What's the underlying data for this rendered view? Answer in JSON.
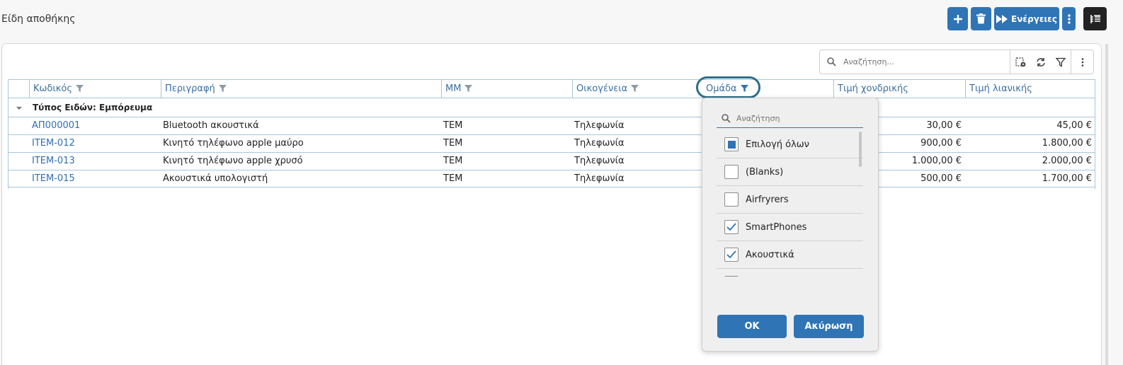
{
  "page": {
    "title": "Είδη αποθήκης"
  },
  "toolbar": {
    "add_icon": "plus-icon",
    "delete_icon": "trash-icon",
    "actions_label": "Ενέργειες",
    "more_icon": "vertical-dots-icon",
    "layout_icon": "list-tree-icon"
  },
  "grid_tools": {
    "search_placeholder": "Αναζήτηση...",
    "icons": [
      "add-view-icon",
      "refresh-icon",
      "filter-icon",
      "vertical-dots-icon"
    ]
  },
  "columns": [
    {
      "label": "Κωδικός",
      "filter": true
    },
    {
      "label": "Περιγραφή",
      "filter": true
    },
    {
      "label": "ΜΜ",
      "filter": true
    },
    {
      "label": "Οικογένεια",
      "filter": true
    },
    {
      "label": "Ομάδα",
      "filter": true,
      "active_filter": true
    },
    {
      "label": "Τιμή χονδρικής",
      "filter": false
    },
    {
      "label": "Τιμή λιανικής",
      "filter": false
    }
  ],
  "group": {
    "label": "Τύπος Ειδών: Εμπόρευμα"
  },
  "rows": [
    {
      "code": "ΑΠ000001",
      "description": "Bluetooth ακουστικά",
      "unit": "ΤΕΜ",
      "family": "Τηλεφωνία",
      "wholesale": "30,00 €",
      "retail": "45,00 €"
    },
    {
      "code": "ITEM-012",
      "description": "Κινητό τηλέφωνο apple μαύρο",
      "unit": "ΤΕΜ",
      "family": "Τηλεφωνία",
      "wholesale": "900,00 €",
      "retail": "1.800,00 €"
    },
    {
      "code": "ITEM-013",
      "description": "Κινητό τηλέφωνο apple χρυσό",
      "unit": "ΤΕΜ",
      "family": "Τηλεφωνία",
      "wholesale": "1.000,00 €",
      "retail": "2.000,00 €"
    },
    {
      "code": "ITEM-015",
      "description": "Ακουστικά υπολογιστή",
      "unit": "ΤΕΜ",
      "family": "Τηλεφωνία",
      "wholesale": "500,00 €",
      "retail": "1.700,00 €"
    }
  ],
  "filter_dropdown": {
    "search_placeholder": "Αναζήτηση",
    "options": [
      {
        "label": "Επιλογή όλων",
        "state": "indeterminate"
      },
      {
        "label": "(Blanks)",
        "state": "unchecked"
      },
      {
        "label": "Airfryrers",
        "state": "unchecked"
      },
      {
        "label": "SmartPhones",
        "state": "checked"
      },
      {
        "label": "Ακουστικά",
        "state": "checked"
      }
    ],
    "ok_label": "OK",
    "cancel_label": "Ακύρωση"
  },
  "colors": {
    "accent": "#2f74b5",
    "header_text": "#3a6fa3",
    "grid_border": "#a9c4dd"
  }
}
